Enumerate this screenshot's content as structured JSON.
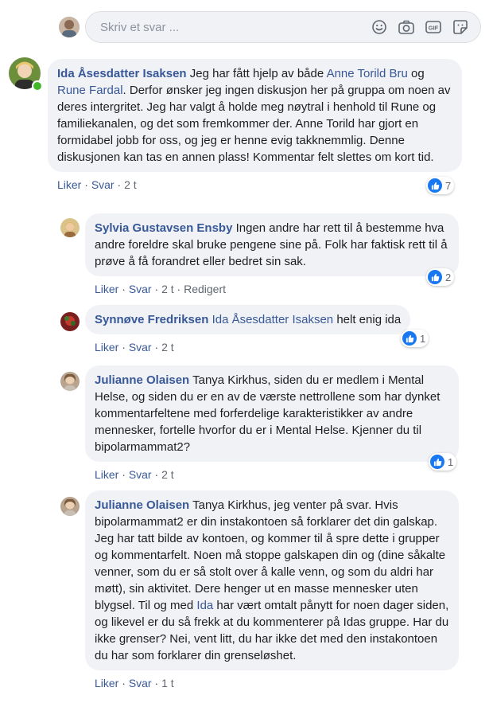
{
  "reply_bar": {
    "placeholder": "Skriv et svar ..."
  },
  "comments": [
    {
      "author": "Ida Åsesdatter Isaksen",
      "t1": " Jeg har fått hjelp av både ",
      "m1": "Anne Torild Bru",
      "t2": " og ",
      "m2": "Rune Fardal",
      "t3": ". Derfor ønsker jeg ingen diskusjon her på gruppa om noen av deres intergritet. Jeg har valgt å holde meg nøytral i henhold til Rune og familiekanalen, og det som fremkommer der. Anne Torild har gjort en formidabel jobb for oss, og jeg er henne evig takknemmlig. Denne diskusjonen kan tas en annen plass! Kommentar felt slettes om kort tid.",
      "like": "Liker",
      "reply": "Svar",
      "time": "2 t",
      "reactions": "7"
    },
    {
      "author": "Sylvia Gustavsen Ensby",
      "text": " Ingen andre har rett til å bestemme hva andre foreldre skal bruke pengene sine på. Folk har faktisk rett til å prøve å få forandret eller bedret sin sak.",
      "like": "Liker",
      "reply": "Svar",
      "time": "2 t",
      "edited": "Redigert",
      "reactions": "2"
    },
    {
      "author": "Synnøve Fredriksen",
      "mention": "Ida Åsesdatter Isaksen",
      "text": " helt enig ida",
      "like": "Liker",
      "reply": "Svar",
      "time": "2 t",
      "reactions": "1"
    },
    {
      "author": "Julianne Olaisen",
      "text": " Tanya Kirkhus, siden du er medlem i Mental Helse, og siden du er en av de værste nettrollene som har dynket kommentarfeltene med forferdelige karakteristikker av andre mennesker, fortelle hvorfor du er i Mental Helse. Kjenner du til bipolarmammat2?",
      "like": "Liker",
      "reply": "Svar",
      "time": "2 t",
      "reactions": "1"
    },
    {
      "author": "Julianne Olaisen",
      "t1": " Tanya Kirkhus, jeg venter på svar. Hvis bipolarmammat2 er din instakontoen så forklarer det din galskap. Jeg har tatt bilde av kontoen, og kommer til å spre dette i grupper og kommentarfelt. Noen må stoppe galskapen din og (dine såkalte venner, som du er så stolt over å kalle venn, og som du aldri har møtt), sin aktivitet. Dere henger ut en masse mennesker uten blygsel. Til og med ",
      "m1": "Ida",
      "t2": " har vært omtalt pånytt for noen dager siden, og likevel er du så frekk at du kommenterer på Idas gruppe. Har du ikke grenser? Nei, vent litt, du har ikke det med den instakontoen du har som forklarer din grenseløshet.",
      "like": "Liker",
      "reply": "Svar",
      "time": "1 t"
    }
  ],
  "colors": {
    "link": "#385898",
    "bubble": "#f0f2f5",
    "like_blue": "#1877f2",
    "online": "#42b72a"
  }
}
